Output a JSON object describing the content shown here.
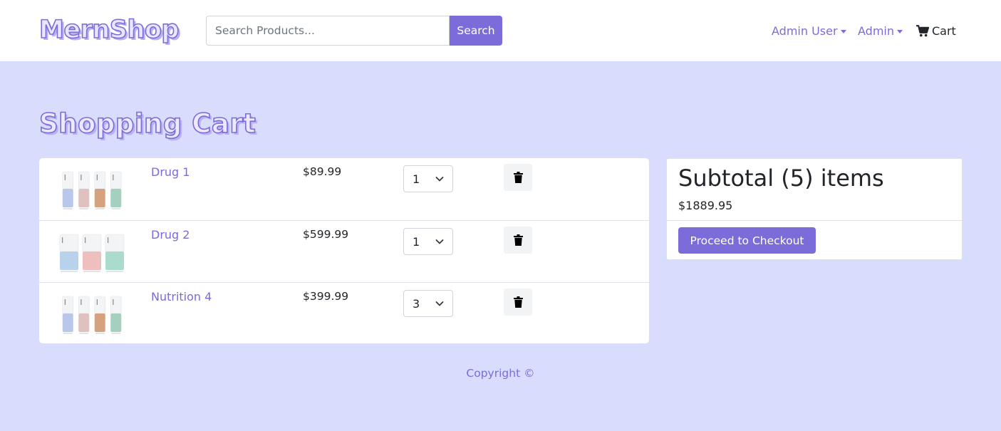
{
  "header": {
    "brand": "MernShop",
    "search": {
      "placeholder": "Search Products...",
      "value": ""
    },
    "search_button": "Search",
    "nav": {
      "admin_user": "Admin User",
      "admin": "Admin",
      "cart": "Cart"
    }
  },
  "page": {
    "title": "Shopping Cart"
  },
  "cart": {
    "items": [
      {
        "name": "Drug 1",
        "price": "$89.99",
        "qty": "1",
        "thumb_colors": [
          "#b9c8ea",
          "#dfc2c0",
          "#d6a27d",
          "#a5cfbe"
        ]
      },
      {
        "name": "Drug 2",
        "price": "$599.99",
        "qty": "1",
        "thumb_colors": [
          "#b7d2ea",
          "#efbfbd",
          "#a9dccd"
        ]
      },
      {
        "name": "Nutrition 4",
        "price": "$399.99",
        "qty": "3",
        "thumb_colors": [
          "#b9c8ea",
          "#dfc2c0",
          "#d6a27d",
          "#a5cfbe"
        ]
      }
    ]
  },
  "summary": {
    "title": "Subtotal (5) items",
    "total": "$1889.95",
    "checkout_button": "Proceed to Checkout"
  },
  "footer": {
    "text": "Copyright ©"
  },
  "colors": {
    "accent": "#7b6cd9",
    "page_background": "#d9ddfd"
  }
}
